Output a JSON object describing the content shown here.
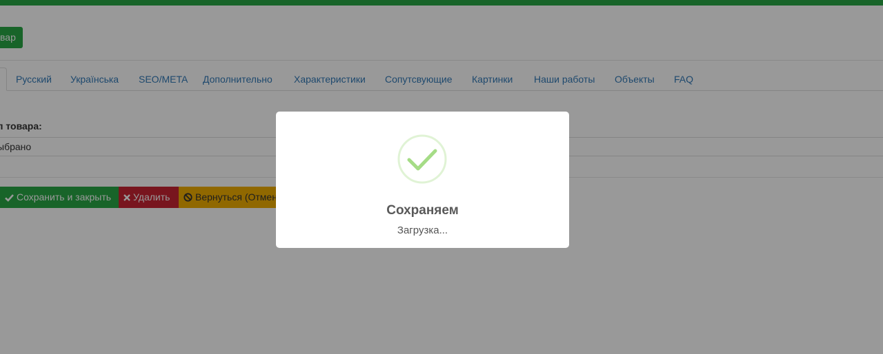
{
  "header": {
    "add_button_label": "вар"
  },
  "tabs": [
    {
      "label": "Русский"
    },
    {
      "label": "Українська"
    },
    {
      "label": "SEO/META"
    },
    {
      "label": "Дополнительно"
    },
    {
      "label": "Характеристики"
    },
    {
      "label": "Сопутсвующие"
    },
    {
      "label": "Картинки"
    },
    {
      "label": "Наши работы"
    },
    {
      "label": "Объекты"
    },
    {
      "label": "FAQ"
    }
  ],
  "form": {
    "type_label": "п товара:",
    "type_value": "ыбрано"
  },
  "actions": {
    "save_close": "Сохранить и закрыть",
    "delete": "Удалить",
    "back": "Вернуться (Отмен"
  },
  "modal": {
    "title": "Сохраняем",
    "text": "Загрузка...",
    "icon": "success-check-icon"
  },
  "colors": {
    "primary_green": "#28a745",
    "danger_red": "#c82333",
    "warning_yellow": "#f0ad00",
    "link_blue": "#337ab7",
    "success_icon": "#a5dc86"
  }
}
